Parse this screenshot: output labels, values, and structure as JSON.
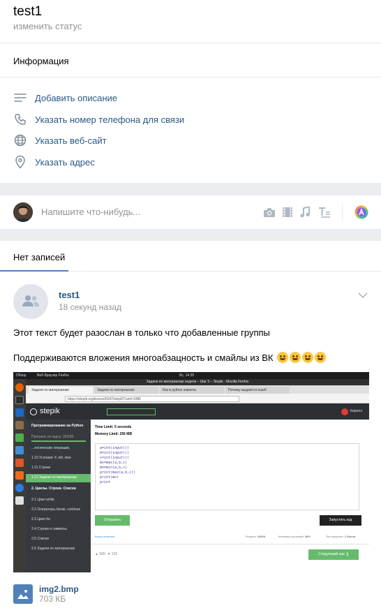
{
  "profile": {
    "name": "test1",
    "status_placeholder": "изменить статус",
    "info_title": "Информация",
    "info_items": [
      {
        "icon": "lines-icon",
        "label": "Добавить описание"
      },
      {
        "icon": "phone-icon",
        "label": "Указать номер телефона для связи"
      },
      {
        "icon": "globe-icon",
        "label": "Указать веб-сайт"
      },
      {
        "icon": "location-pin-icon",
        "label": "Указать адрес"
      }
    ]
  },
  "composer": {
    "placeholder": "Напишите что-нибудь...",
    "attach_icons": [
      "camera-icon",
      "video-icon",
      "music-icon",
      "text-format-icon",
      "color-palette-icon"
    ]
  },
  "posts": {
    "tab_label": "Нет записей",
    "post": {
      "author": "test1",
      "time": "18 секунд назад",
      "text_line1": "Этот текст будет разослан в только что добавленные группы",
      "text_line2": "Поддерживаются вложения многоабзацность и смайлы из ВК",
      "attachment": {
        "file_name": "img2.bmp",
        "file_size": "703 КБ"
      }
    }
  },
  "screenshot": {
    "topbar_left": "Обзор",
    "topbar_browser": "Веб-браузер Firefox",
    "topbar_time": "Вс, 14:35",
    "window_title": "Задачи по материалам недели – Шаг 5 – Stepik - Mozilla Firefox",
    "tabs": [
      "Задачи по материалам",
      "Задачи по материалам",
      "Как в python извлечь",
      "Почему выдается ошиб"
    ],
    "url": "https://stepik.org/lesson/5047/step/5?unit=1086",
    "logo": "stepik",
    "user": "Кирилл",
    "course_title": "Программирование на Python",
    "progress": "Прогресс по курсу: 26/100",
    "side_items": [
      "...логические операции,",
      "1.10 Условия: if, elif, else",
      "1.11 Строки",
      "1.12 Задачи по материалам",
      "2. Циклы. Строки. Списки",
      "2.1 Цикл while",
      "2.2 Операторы break, continue",
      "2.3 Цикл for",
      "2.4 Строки и символы",
      "2.5 Списки",
      "2.6 Задачи по материалам"
    ],
    "time_limit": "Time Limit: 5 seconds",
    "memory_limit": "Memory Limit: 256 MB",
    "code_lines": [
      "a=int(input())",
      "b=int(input())",
      "c=int(input())",
      "mx=max(a,b,c)",
      "mn=min(a,b,c)",
      "print(max(a,b,c))",
      "print(mn)",
      "print"
    ],
    "submit": "Отправить",
    "run": "Запустить код",
    "your_solutions": "Ваши решения",
    "solved_label": "Решило:",
    "solved": "28929",
    "success_label": "Успешных решений:",
    "success": "38%",
    "points_label": "Вы получите:",
    "points": "2 балла",
    "likes": "589",
    "dislikes": "102",
    "next_step": "Следующий шаг"
  }
}
